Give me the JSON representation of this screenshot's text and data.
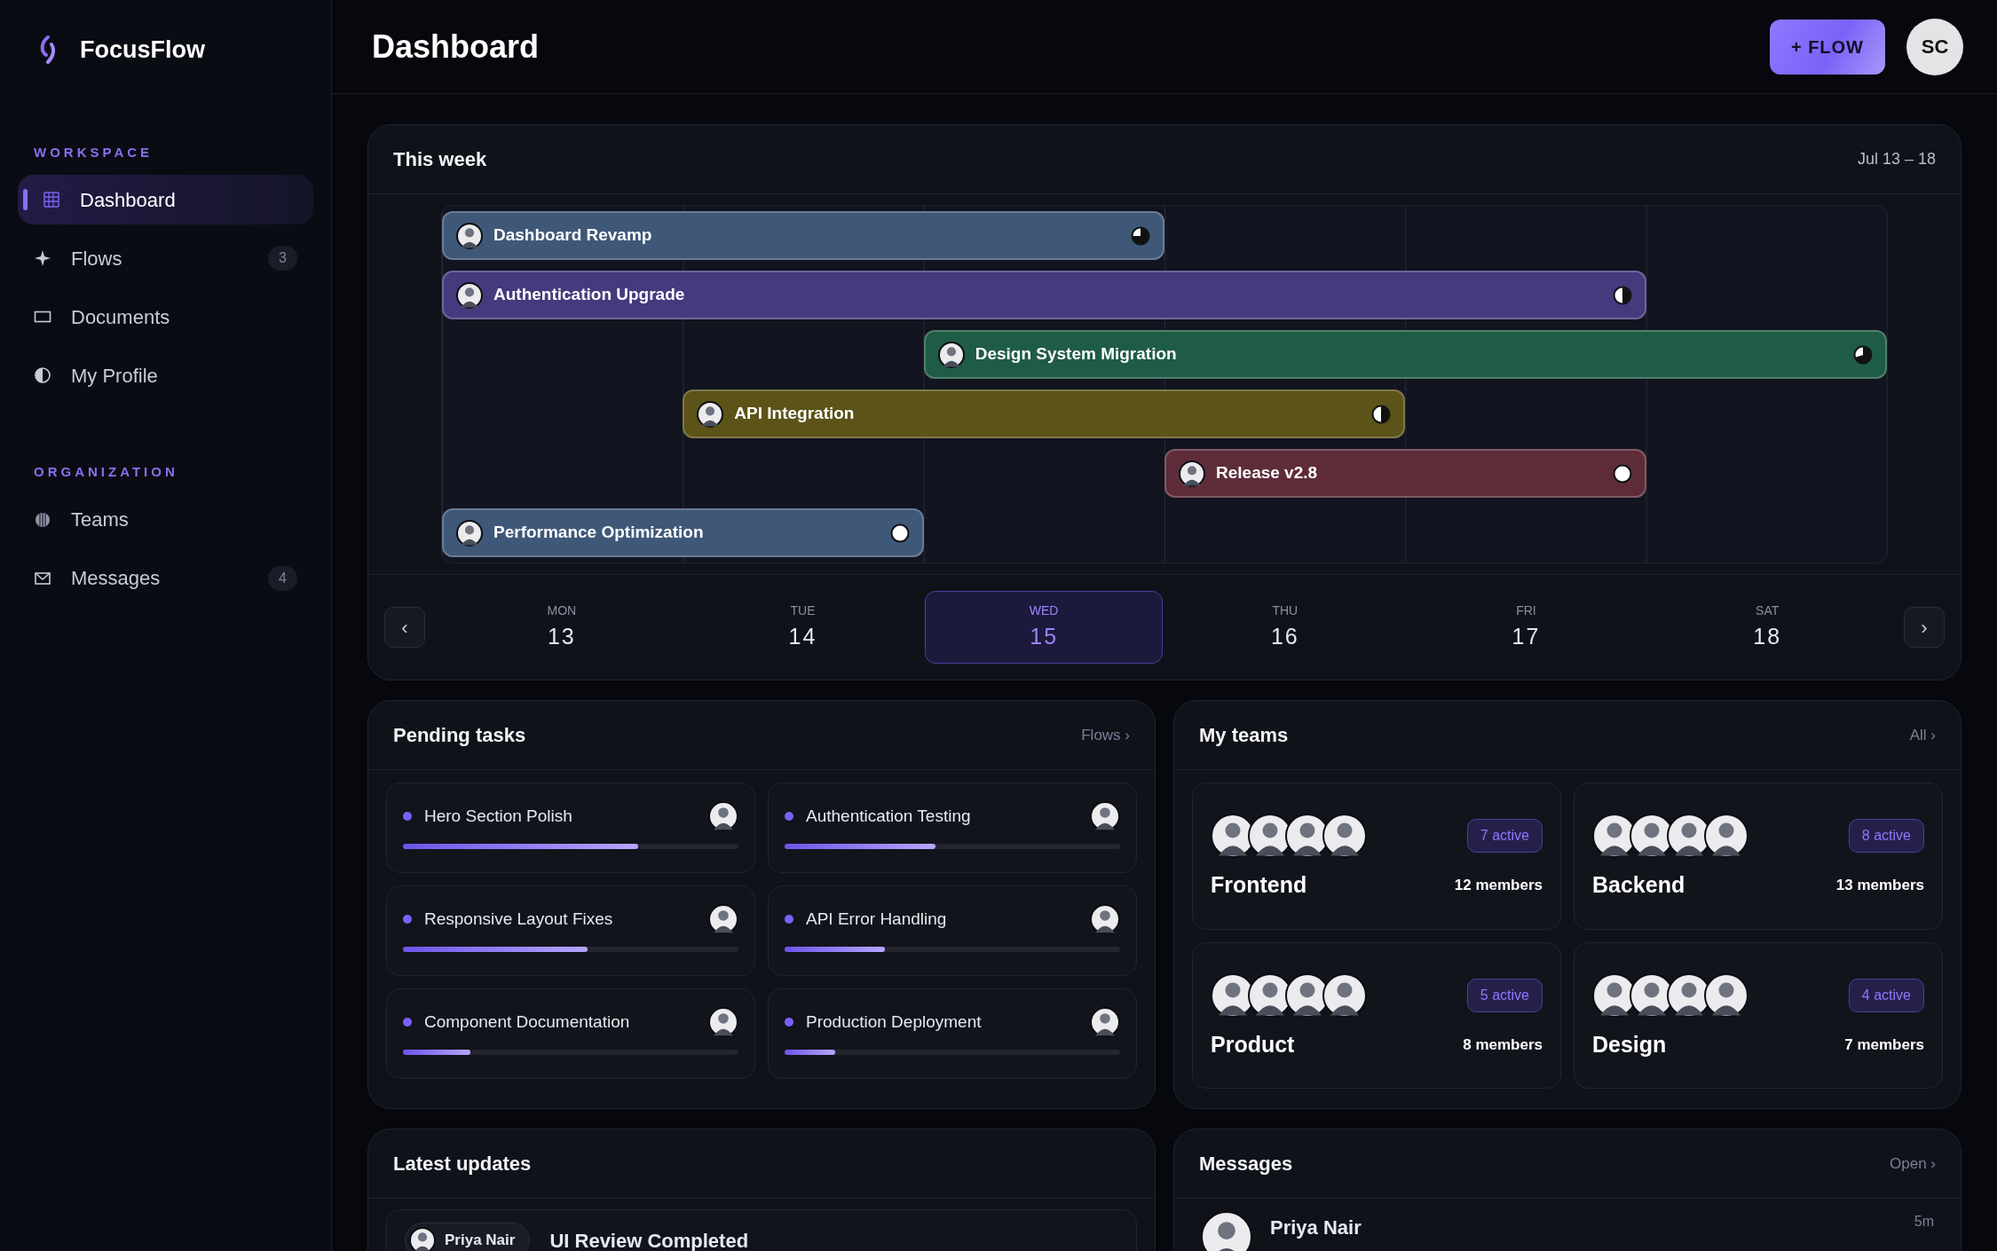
{
  "app": {
    "name": "FocusFlow"
  },
  "sidebar": {
    "sections": [
      {
        "title": "WORKSPACE",
        "items": [
          {
            "label": "Dashboard",
            "selected": true
          },
          {
            "label": "Flows",
            "badge": "3",
            "selected": false
          },
          {
            "label": "Documents",
            "selected": false
          },
          {
            "label": "My Profile",
            "selected": false
          }
        ]
      },
      {
        "title": "ORGANIZATION",
        "items": [
          {
            "label": "Teams",
            "selected": false
          },
          {
            "label": "Messages",
            "badge": "4",
            "selected": false
          }
        ]
      }
    ]
  },
  "header": {
    "title": "Dashboard",
    "new_button": "+ FLOW",
    "user_initials": "SC"
  },
  "week": {
    "title": "This week",
    "range": "Jul 13 – 18",
    "bars": [
      {
        "label": "Dashboard Revamp",
        "color": "#3f5878",
        "level": 0.75
      },
      {
        "label": "Authentication Upgrade",
        "color": "#453a7e",
        "level": 0.5
      },
      {
        "label": "Design System Migration",
        "color": "#1f5c45",
        "level": 0.7
      },
      {
        "label": "API Integration",
        "color": "#5c5318",
        "level": 0.5
      },
      {
        "label": "Release v2.8",
        "color": "#5e2c39",
        "level": 0
      },
      {
        "label": "Performance Optimization",
        "color": "#3f5878",
        "level": 0
      }
    ],
    "prev": "‹",
    "next": "›",
    "days": [
      {
        "weekday": "MON",
        "day": "13",
        "selected": false
      },
      {
        "weekday": "TUE",
        "day": "14",
        "selected": false
      },
      {
        "weekday": "WED",
        "day": "15",
        "selected": true
      },
      {
        "weekday": "THU",
        "day": "16",
        "selected": false
      },
      {
        "weekday": "FRI",
        "day": "17",
        "selected": false
      },
      {
        "weekday": "SAT",
        "day": "18",
        "selected": false
      }
    ]
  },
  "pending": {
    "title": "Pending tasks",
    "link": "Flows ›",
    "tasks": [
      {
        "title": "Hero Section Polish",
        "level": 0.7
      },
      {
        "title": "Authentication Testing",
        "level": 0.45
      },
      {
        "title": "Responsive Layout Fixes",
        "level": 0.55
      },
      {
        "title": "API Error Handling",
        "level": 0.3
      },
      {
        "title": "Component Documentation",
        "level": 0.2
      },
      {
        "title": "Production Deployment",
        "level": 0.15
      }
    ]
  },
  "teams": {
    "title": "My teams",
    "link": "All ›",
    "items": [
      {
        "name": "Frontend",
        "active": "7 active",
        "members": "12 members"
      },
      {
        "name": "Backend",
        "active": "8 active",
        "members": "13 members"
      },
      {
        "name": "Product",
        "active": "5 active",
        "members": "8 members"
      },
      {
        "name": "Design",
        "active": "4 active",
        "members": "7 members"
      }
    ]
  },
  "updates": {
    "title": "Latest updates",
    "items": [
      {
        "author": "Priya Nair",
        "title": "UI Review Completed"
      }
    ]
  },
  "messages": {
    "title": "Messages",
    "link": "Open ›",
    "items": [
      {
        "name": "Priya Nair",
        "time": "5m"
      }
    ]
  }
}
